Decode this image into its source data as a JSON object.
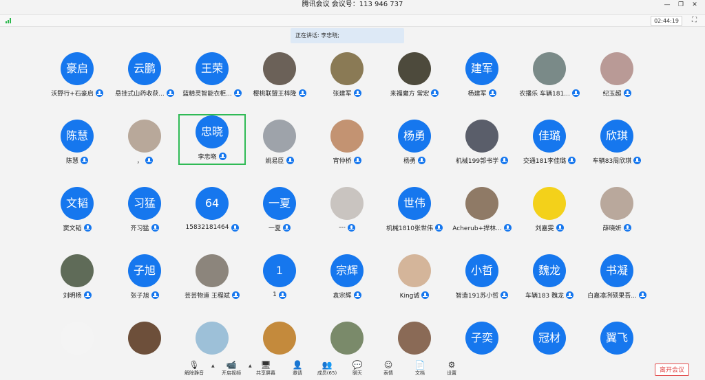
{
  "window": {
    "title": "腾讯会议 会议号：113 946 737"
  },
  "status": {
    "timer": "02:44:19",
    "speaking": "正在讲话: 李忠晓;"
  },
  "colors": {
    "avatar": "#1677ee",
    "active_border": "#2fba55",
    "leave": "#e24b4b"
  },
  "participants": [
    {
      "avatar": "豪启",
      "name": "沃野行+石豪启",
      "mic": true
    },
    {
      "avatar": "云鹏",
      "name": "悬挂式山药收获...",
      "mic": true
    },
    {
      "avatar": "王荣",
      "name": "蓝精灵智能衣柜...",
      "mic": true
    },
    {
      "avatar": "",
      "photo": "#6b6158",
      "name": "樱桃联盟王梓隆",
      "mic": true
    },
    {
      "avatar": "",
      "photo": "#8a7a55",
      "name": "张建军",
      "mic": true
    },
    {
      "avatar": "",
      "photo": "#4d4a3c",
      "name": "来福魔方 常宏",
      "mic": true
    },
    {
      "avatar": "建军",
      "name": "杨建军",
      "mic": true
    },
    {
      "avatar": "",
      "photo": "#7a8a88",
      "name": "农播乐 车辆181...",
      "mic": true
    },
    {
      "avatar": "",
      "photo": "#b99a96",
      "name": "纪玉超",
      "mic": true
    },
    {
      "avatar": "陈慧",
      "name": "陈慧",
      "mic": true
    },
    {
      "avatar": "",
      "photo": "#b8a89a",
      "name": "，",
      "mic": true
    },
    {
      "avatar": "忠晓",
      "name": "李忠晓",
      "mic": true,
      "active": true
    },
    {
      "avatar": "",
      "photo": "#9ea3aa",
      "name": "姚易臣",
      "mic": true
    },
    {
      "avatar": "",
      "photo": "#c39372",
      "name": "宵仲桥",
      "mic": true
    },
    {
      "avatar": "杨勇",
      "name": "杨勇",
      "mic": true
    },
    {
      "avatar": "",
      "photo": "#5a5e6a",
      "name": "机械199郭书学",
      "mic": true
    },
    {
      "avatar": "佳璐",
      "name": "交通181李佳璐",
      "mic": true
    },
    {
      "avatar": "欣琪",
      "name": "车辆83周欣琪",
      "mic": true
    },
    {
      "avatar": "文韬",
      "name": "窦文韬",
      "mic": true
    },
    {
      "avatar": "习猛",
      "name": "齐习猛",
      "mic": true
    },
    {
      "avatar": "64",
      "name": "15832181464",
      "mic": true
    },
    {
      "avatar": "一夏",
      "name": "一夏",
      "mic": true
    },
    {
      "avatar": "",
      "photo": "#c9c4c0",
      "name": "---",
      "mic": true
    },
    {
      "avatar": "世伟",
      "name": "机械1810张世伟",
      "mic": true
    },
    {
      "avatar": "",
      "photo": "#8f7a66",
      "name": "Acherub+捍林...",
      "mic": true
    },
    {
      "avatar": "",
      "photo": "#f3d11a",
      "name": "刘嘉雯",
      "mic": true
    },
    {
      "avatar": "",
      "photo": "#b9a89c",
      "name": "薛晓妍",
      "mic": true
    },
    {
      "avatar": "",
      "photo": "#5f6b58",
      "name": "刘明杨",
      "mic": true
    },
    {
      "avatar": "子旭",
      "name": "张子旭",
      "mic": true
    },
    {
      "avatar": "",
      "photo": "#8c857c",
      "name": "芸芸物道 王程斌",
      "mic": true
    },
    {
      "avatar": "1",
      "name": "1",
      "mic": true
    },
    {
      "avatar": "宗辉",
      "name": "袁宗辉",
      "mic": true
    },
    {
      "avatar": "",
      "photo": "#d4b59a",
      "name": "King诚",
      "mic": true
    },
    {
      "avatar": "小哲",
      "name": "智造191苏小哲",
      "mic": true
    },
    {
      "avatar": "魏龙",
      "name": "车辆183 魏龙",
      "mic": true
    },
    {
      "avatar": "书凝",
      "name": "白嘉凛冽硕果吾...",
      "mic": true
    },
    {
      "avatar": "",
      "photo": "#f4f4f4",
      "name": "",
      "mic": false
    },
    {
      "avatar": "",
      "photo": "#6d4f3a",
      "name": "",
      "mic": false
    },
    {
      "avatar": "",
      "photo": "#9dc0d8",
      "name": "",
      "mic": false
    },
    {
      "avatar": "",
      "photo": "#c48a3c",
      "name": "",
      "mic": false
    },
    {
      "avatar": "",
      "photo": "#7a8a6a",
      "name": "",
      "mic": false
    },
    {
      "avatar": "",
      "photo": "#8a6a56",
      "name": "",
      "mic": false
    },
    {
      "avatar": "子奕",
      "name": "",
      "mic": false
    },
    {
      "avatar": "冠材",
      "name": "",
      "mic": false
    },
    {
      "avatar": "翼飞",
      "name": "",
      "mic": false
    }
  ],
  "toolbar": [
    {
      "label": "解除静音",
      "icon": "mic-muted-icon",
      "glyph": "🎙",
      "caret": true
    },
    {
      "label": "开启视频",
      "icon": "video-off-icon",
      "glyph": "📹",
      "caret": true
    },
    {
      "label": "共享屏幕",
      "icon": "share-screen-icon",
      "glyph": "🖥"
    },
    {
      "label": "邀请",
      "icon": "invite-icon",
      "glyph": "👤"
    },
    {
      "label": "成员(65)",
      "icon": "members-icon",
      "glyph": "👥"
    },
    {
      "label": "聊天",
      "icon": "chat-icon",
      "glyph": "💬"
    },
    {
      "label": "表情",
      "icon": "emoji-icon",
      "glyph": "☺"
    },
    {
      "label": "文档",
      "icon": "document-icon",
      "glyph": "📄"
    },
    {
      "label": "设置",
      "icon": "settings-icon",
      "glyph": "⚙"
    }
  ],
  "leave_label": "离开会议"
}
